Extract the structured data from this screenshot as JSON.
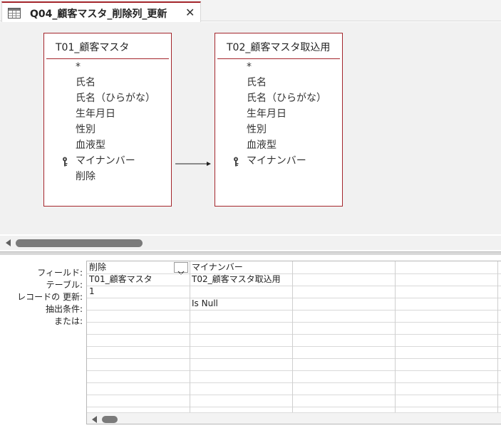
{
  "tab": {
    "title": "Q04_顧客マスタ_削除列_更新",
    "close_glyph": "✕",
    "icon": "query-icon"
  },
  "tables": [
    {
      "name": "T01_顧客マスタ",
      "fields": [
        {
          "label": "*",
          "key": false
        },
        {
          "label": "氏名",
          "key": false
        },
        {
          "label": "氏名（ひらがな）",
          "key": false
        },
        {
          "label": "生年月日",
          "key": false
        },
        {
          "label": "性別",
          "key": false
        },
        {
          "label": "血液型",
          "key": false
        },
        {
          "label": "マイナンバー",
          "key": true
        },
        {
          "label": "削除",
          "key": false
        }
      ]
    },
    {
      "name": "T02_顧客マスタ取込用",
      "fields": [
        {
          "label": "*",
          "key": false
        },
        {
          "label": "氏名",
          "key": false
        },
        {
          "label": "氏名（ひらがな）",
          "key": false
        },
        {
          "label": "生年月日",
          "key": false
        },
        {
          "label": "性別",
          "key": false
        },
        {
          "label": "血液型",
          "key": false
        },
        {
          "label": "マイナンバー",
          "key": true
        }
      ]
    }
  ],
  "grid": {
    "row_labels": [
      "フィールド:",
      "テーブル:",
      "レコードの 更新:",
      "抽出条件:",
      "または:"
    ],
    "columns": [
      {
        "field": "削除",
        "table": "T01_顧客マスタ",
        "update": "1",
        "criteria": "",
        "or": ""
      },
      {
        "field": "マイナンバー",
        "table": "T02_顧客マスタ取込用",
        "update": "",
        "criteria": "Is Null",
        "or": ""
      },
      {
        "field": "",
        "table": "",
        "update": "",
        "criteria": "",
        "or": ""
      },
      {
        "field": "",
        "table": "",
        "update": "",
        "criteria": "",
        "or": ""
      }
    ]
  },
  "colors": {
    "accent": "#a4262c",
    "design_bg": "#f1f1f1"
  }
}
